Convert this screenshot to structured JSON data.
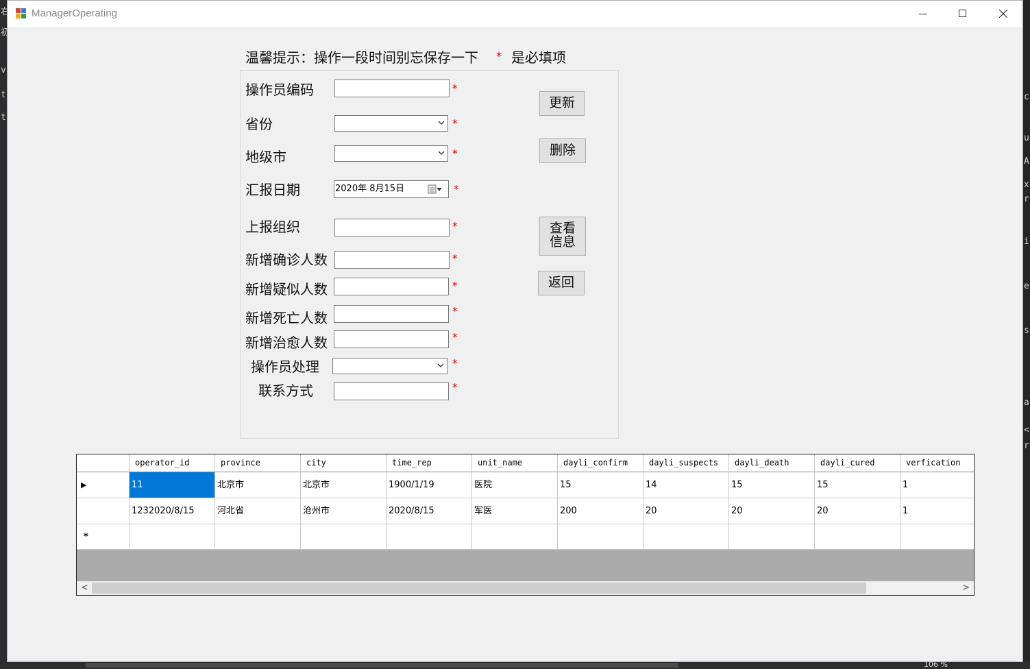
{
  "window": {
    "title": "ManagerOperating",
    "minimize": "—",
    "maximize": "☐",
    "close": "✕"
  },
  "hint": {
    "text": "温馨提示：操作一段时间别忘保存一下",
    "required_star": "*",
    "required_note": "是必填项"
  },
  "form": {
    "operator_code_label": "操作员编码",
    "province_label": "省份",
    "city_label": "地级市",
    "report_date_label": "汇报日期",
    "report_date_value": "2020年  8月15日",
    "org_label": "上报组织",
    "new_confirmed_label": "新增确诊人数",
    "new_suspected_label": "新增疑似人数",
    "new_death_label": "新增死亡人数",
    "new_cured_label": "新增治愈人数",
    "operator_process_label": "操作员处理",
    "contact_label": "联系方式",
    "star": "*"
  },
  "buttons": {
    "update": "更新",
    "delete": "删除",
    "view_info_1": "查看",
    "view_info_2": "信息",
    "back": "返回"
  },
  "grid": {
    "columns": [
      "operator_id",
      "province",
      "city",
      "time_rep",
      "unit_name",
      "dayli_confirm",
      "dayli_suspects",
      "dayli_death",
      "dayli_cured",
      "verfication"
    ],
    "rows": [
      [
        "11",
        "北京市",
        "北京市",
        "1900/1/19",
        "医院",
        "15",
        "14",
        "15",
        "15",
        "1"
      ],
      [
        "1232020/8/15",
        "河北省",
        "沧州市",
        "2020/8/15",
        "军医",
        "200",
        "20",
        "20",
        "20",
        "1"
      ]
    ],
    "current_row_marker": "▶",
    "new_row_marker": "*",
    "scroll_left": "<",
    "scroll_right": ">"
  },
  "background": {
    "zoom": "106 %"
  }
}
